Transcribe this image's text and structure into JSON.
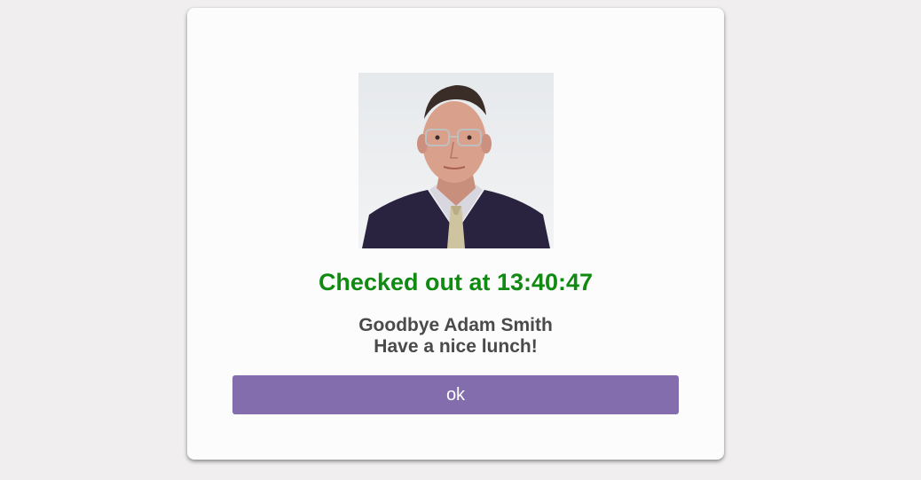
{
  "dialog": {
    "status_text": "Checked out at 13:40:47",
    "message_line1": "Goodbye Adam Smith",
    "message_line2": "Have a nice lunch!",
    "ok_label": "ok",
    "photo_alt": "Adam Smith"
  },
  "colors": {
    "status": "#118a12",
    "button": "#836dac",
    "text": "#4a4a4a",
    "background": "#f0eeef"
  }
}
